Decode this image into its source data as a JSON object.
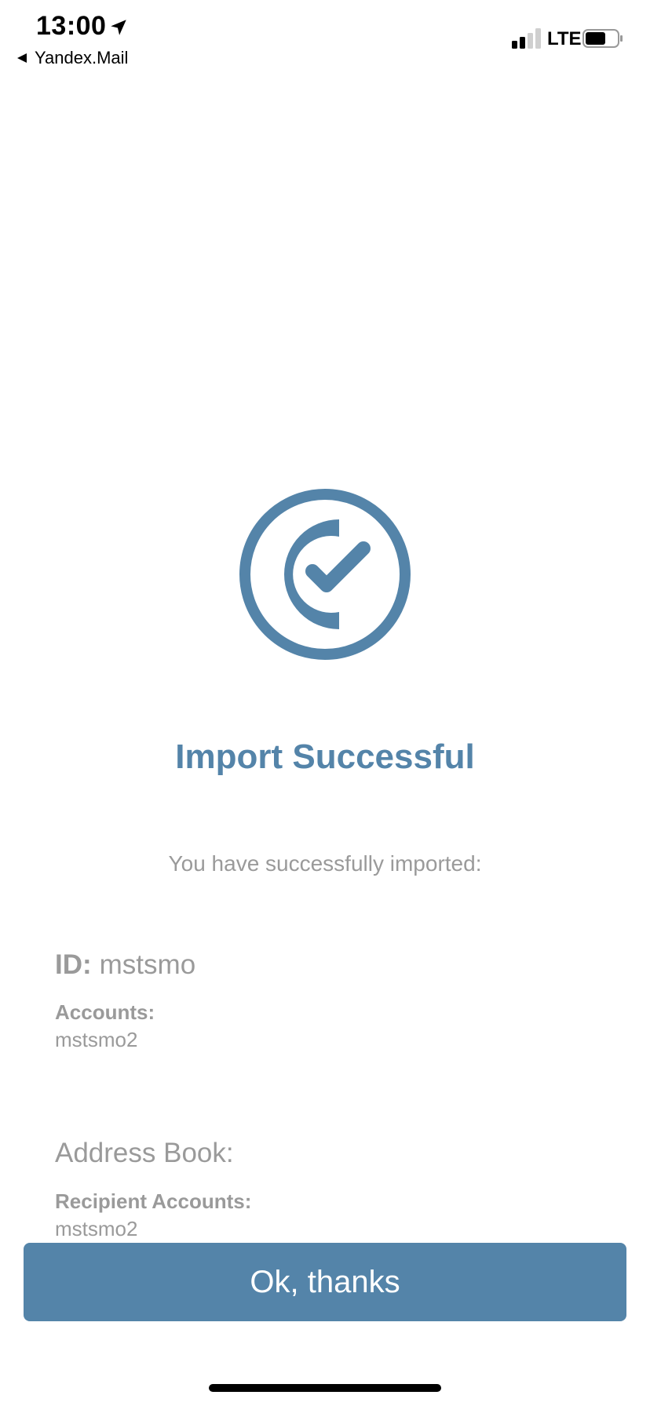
{
  "status_bar": {
    "time": "13:00",
    "back_app_label": "Yandex.Mail",
    "network": "LTE",
    "icons": [
      "location-arrow-icon",
      "back-arrow-icon",
      "signal-icon",
      "battery-icon"
    ]
  },
  "main": {
    "icon": "check-circle-icon",
    "title": "Import Successful",
    "subtitle": "You have successfully imported:",
    "id_label": "ID:",
    "id_value": "mstsmo",
    "accounts_label": "Accounts:",
    "accounts_value": "mstsmo2",
    "address_book_label": "Address Book:",
    "recipient_accounts_label": "Recipient Accounts:",
    "recipient_accounts_value": "mstsmo2"
  },
  "actions": {
    "ok_label": "Ok, thanks"
  },
  "colors": {
    "accent": "#5484a9",
    "muted_text": "#9a9a9a",
    "background": "#ffffff"
  }
}
